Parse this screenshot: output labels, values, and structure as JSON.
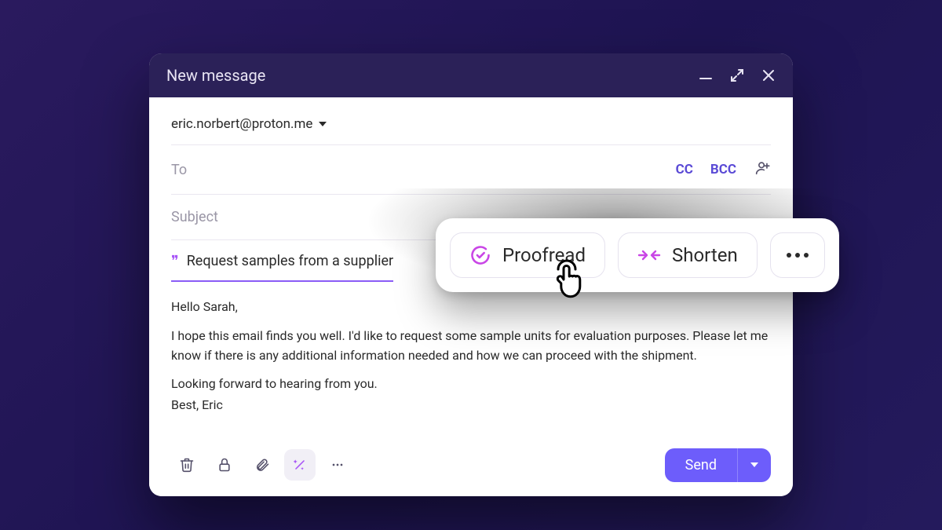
{
  "header": {
    "title": "New message",
    "minimize": "minimize",
    "expand": "expand",
    "close": "close"
  },
  "from": {
    "address": "eric.norbert@proton.me"
  },
  "to": {
    "placeholder": "To",
    "cc": "CC",
    "bcc": "BCC"
  },
  "subject": {
    "placeholder": "Subject"
  },
  "suggestion": {
    "text": "Request samples from a supplier"
  },
  "bodyText": {
    "greeting": "Hello Sarah,",
    "para1": "I hope this email finds you well. I'd like to request some sample units for evaluation purposes. Please let me know if there is any additional information needed and how we can proceed with the shipment.",
    "para2": "Looking forward to hearing from you.",
    "signoff": "Best, Eric"
  },
  "toolbar": {
    "send_label": "Send"
  },
  "ai": {
    "proofread": "Proofread",
    "shorten": "Shorten"
  },
  "colors": {
    "brand": "#6d5dfb",
    "accent": "#a855f7",
    "header_bg": "#2b2158"
  }
}
